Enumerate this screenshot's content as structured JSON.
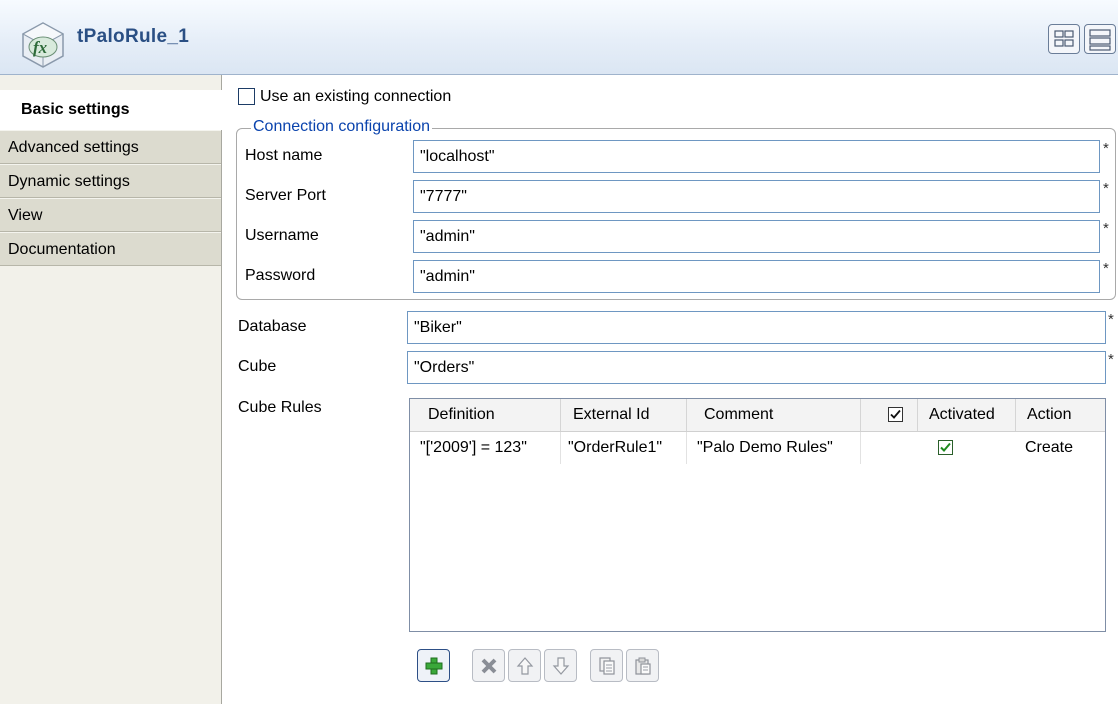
{
  "header": {
    "title": "tPaloRule_1"
  },
  "sidebar": {
    "tabs": [
      {
        "label": "Basic settings"
      },
      {
        "label": "Advanced settings"
      },
      {
        "label": "Dynamic settings"
      },
      {
        "label": "View"
      },
      {
        "label": "Documentation"
      }
    ]
  },
  "form": {
    "use_existing_connection": {
      "label": "Use an existing connection",
      "checked": false
    },
    "connection_group": {
      "legend": "Connection configuration",
      "host": {
        "label": "Host name",
        "value": "\"localhost\""
      },
      "port": {
        "label": "Server Port",
        "value": "\"7777\""
      },
      "username": {
        "label": "Username",
        "value": "\"admin\""
      },
      "password": {
        "label": "Password",
        "value": "\"admin\""
      }
    },
    "database": {
      "label": "Database",
      "value": "\"Biker\""
    },
    "cube": {
      "label": "Cube",
      "value": "\"Orders\""
    },
    "required_marker": "*"
  },
  "cube_rules": {
    "label": "Cube Rules",
    "columns": [
      "Definition",
      "External Id",
      "Comment",
      "",
      "Activated",
      "Action"
    ],
    "header_checkbox_checked": true,
    "rows": [
      {
        "definition": "\"['2009'] = 123\"",
        "external_id": "\"OrderRule1\"",
        "comment": "\"Palo Demo Rules\"",
        "activated": true,
        "action": "Create"
      }
    ]
  },
  "toolbar": {
    "buttons": [
      "add-icon",
      "delete-icon",
      "move-up-icon",
      "move-down-icon",
      "copy-icon",
      "paste-icon"
    ]
  },
  "colors": {
    "title": "#2a4f84",
    "legend": "#0a43ad",
    "field_border": "#6e97c2",
    "check": "#1e8a1e"
  }
}
